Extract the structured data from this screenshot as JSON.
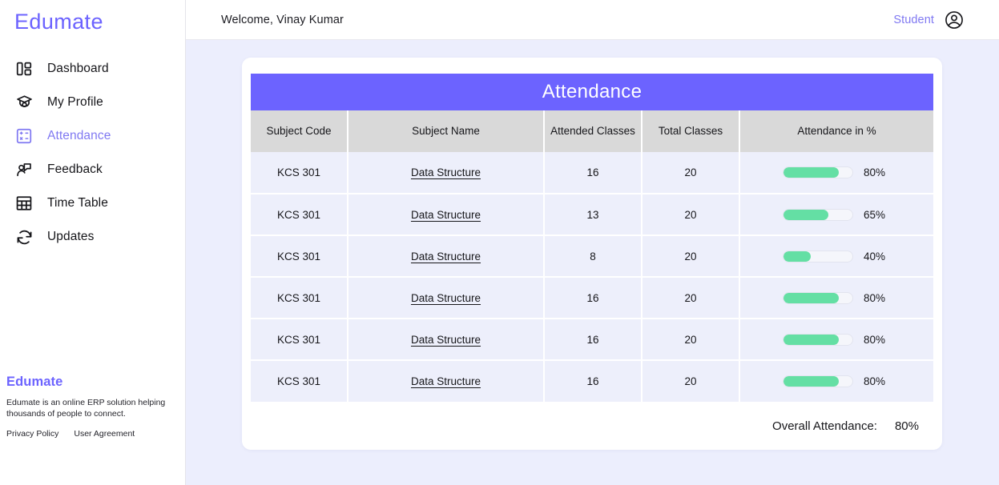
{
  "brand": {
    "name": "Edumate"
  },
  "sidebar": {
    "items": [
      {
        "label": "Dashboard",
        "icon": "dashboard-icon",
        "active": false
      },
      {
        "label": "My Profile",
        "icon": "graduation-cap-icon",
        "active": false
      },
      {
        "label": "Attendance",
        "icon": "attendance-grid-icon",
        "active": true
      },
      {
        "label": "Feedback",
        "icon": "feedback-person-icon",
        "active": false
      },
      {
        "label": "Time Table",
        "icon": "table-grid-icon",
        "active": false
      },
      {
        "label": "Updates",
        "icon": "refresh-icon",
        "active": false
      }
    ],
    "footer": {
      "brand": "Edumate",
      "description": "Edumate is an online ERP solution helping thousands of people to connect.",
      "links": [
        "Privacy Policy",
        "User Agreement"
      ]
    }
  },
  "header": {
    "welcome": "Welcome, Vinay Kumar",
    "role": "Student",
    "avatar_icon": "account-circle-icon"
  },
  "attendance": {
    "title": "Attendance",
    "columns": [
      "Subject Code",
      "Subject Name",
      "Attended Classes",
      "Total Classes",
      "Attendance in %"
    ],
    "rows": [
      {
        "code": "KCS 301",
        "name": "Data Structure",
        "attended": "16",
        "total": "20",
        "percent": "80%",
        "percent_value": 80
      },
      {
        "code": "KCS 301",
        "name": "Data Structure",
        "attended": "13",
        "total": "20",
        "percent": "65%",
        "percent_value": 65
      },
      {
        "code": "KCS 301",
        "name": "Data Structure",
        "attended": "8",
        "total": "20",
        "percent": "40%",
        "percent_value": 40
      },
      {
        "code": "KCS 301",
        "name": "Data Structure",
        "attended": "16",
        "total": "20",
        "percent": "80%",
        "percent_value": 80
      },
      {
        "code": "KCS 301",
        "name": "Data Structure",
        "attended": "16",
        "total": "20",
        "percent": "80%",
        "percent_value": 80
      },
      {
        "code": "KCS 301",
        "name": "Data Structure",
        "attended": "16",
        "total": "20",
        "percent": "80%",
        "percent_value": 80
      }
    ],
    "overall_label": "Overall Attendance:",
    "overall_value": "80%"
  },
  "colors": {
    "accent_purple": "#6c63ff",
    "nav_active": "#8079f2",
    "page_bg": "#eceefd",
    "row_bg": "#edeffb",
    "header_row_bg": "#d9d9d9",
    "bar_fill": "#64dfa4",
    "bar_track": "#f5f6fb"
  }
}
